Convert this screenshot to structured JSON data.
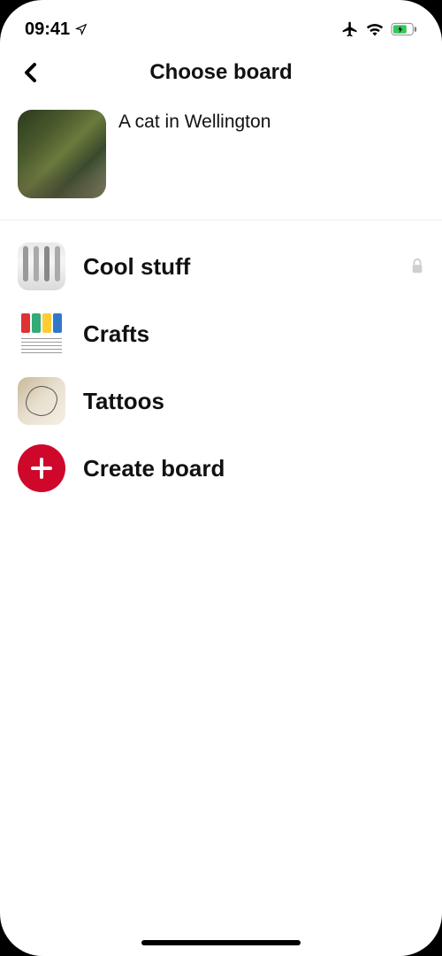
{
  "statusBar": {
    "time": "09:41"
  },
  "header": {
    "title": "Choose board"
  },
  "pin": {
    "title": "A cat in Wellington"
  },
  "boards": [
    {
      "name": "Cool stuff",
      "private": true
    },
    {
      "name": "Crafts",
      "private": false
    },
    {
      "name": "Tattoos",
      "private": false
    }
  ],
  "create": {
    "label": "Create board"
  }
}
